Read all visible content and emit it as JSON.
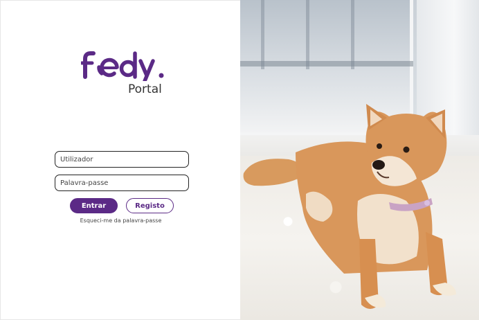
{
  "brand": {
    "logo_text": "fedy.",
    "portal_label": "Portal",
    "color": "#5b2a86"
  },
  "form": {
    "username_placeholder": "Utilizador",
    "password_placeholder": "Palavra-passe",
    "login_label": "Entrar",
    "register_label": "Registo",
    "forgot_label": "Esqueci-me da palavra-passe"
  }
}
